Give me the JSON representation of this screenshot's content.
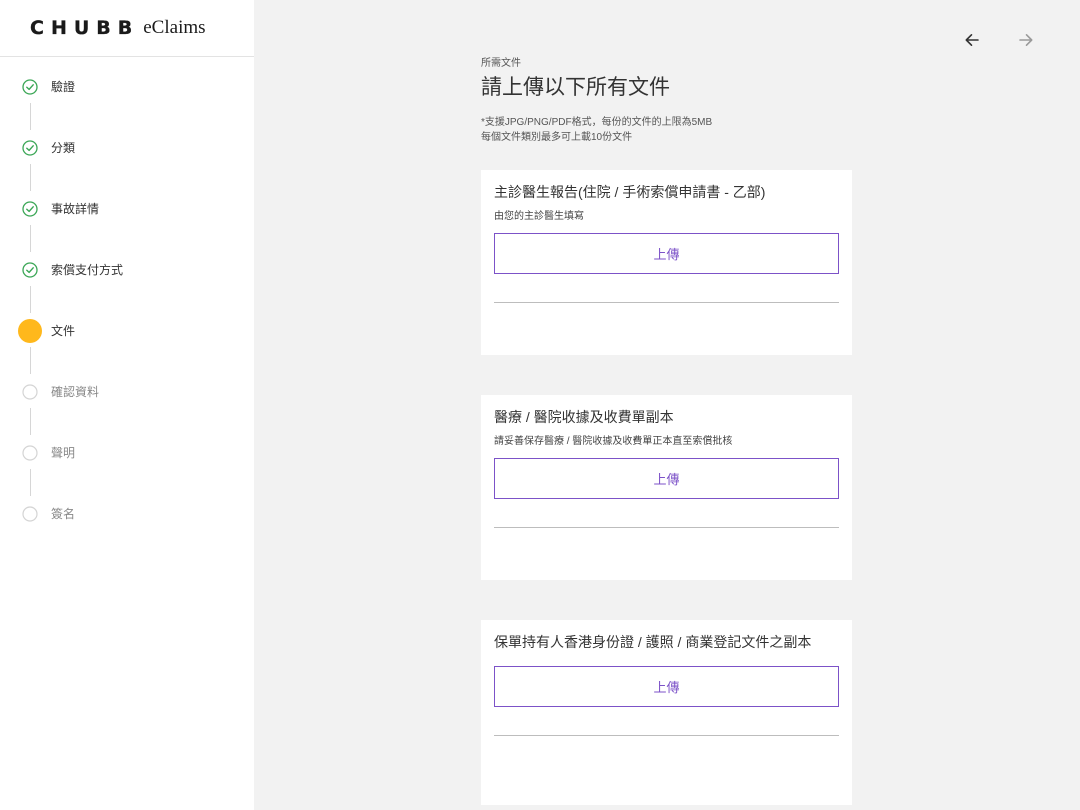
{
  "brand": {
    "logo_text": "CHUBB",
    "product_name": "eClaims"
  },
  "sidebar": {
    "steps": [
      {
        "label": "驗證",
        "status": "completed"
      },
      {
        "label": "分類",
        "status": "completed"
      },
      {
        "label": "事故詳情",
        "status": "completed"
      },
      {
        "label": "索償支付方式",
        "status": "completed"
      },
      {
        "label": "文件",
        "status": "current"
      },
      {
        "label": "確認資料",
        "status": "pending"
      },
      {
        "label": "聲明",
        "status": "pending"
      },
      {
        "label": "簽名",
        "status": "pending"
      }
    ]
  },
  "nav": {
    "back_icon": "arrow-left-icon",
    "forward_icon": "arrow-right-icon"
  },
  "main": {
    "eyebrow": "所需文件",
    "title": "請上傳以下所有文件",
    "note_line1": "*支援JPG/PNG/PDF格式，每份的文件的上限為5MB",
    "note_line2": "每個文件類別最多可上載10份文件",
    "cards": [
      {
        "title": "主診醫生報告(住院 / 手術索償申請書 - 乙部)",
        "description": "由您的主診醫生填寫",
        "button_label": "上傳"
      },
      {
        "title": "醫療 / 醫院收據及收費單副本",
        "description": "請妥善保存醫療 / 醫院收據及收費單正本直至索償批核",
        "button_label": "上傳"
      },
      {
        "title": "保單持有人香港身份證 / 護照 / 商業登記文件之副本",
        "description": "",
        "button_label": "上傳"
      }
    ]
  },
  "colors": {
    "accent_purple": "#7c52c8",
    "step_current": "#ffb81c",
    "step_completed": "#3aa655",
    "background": "#f2f2f2"
  }
}
